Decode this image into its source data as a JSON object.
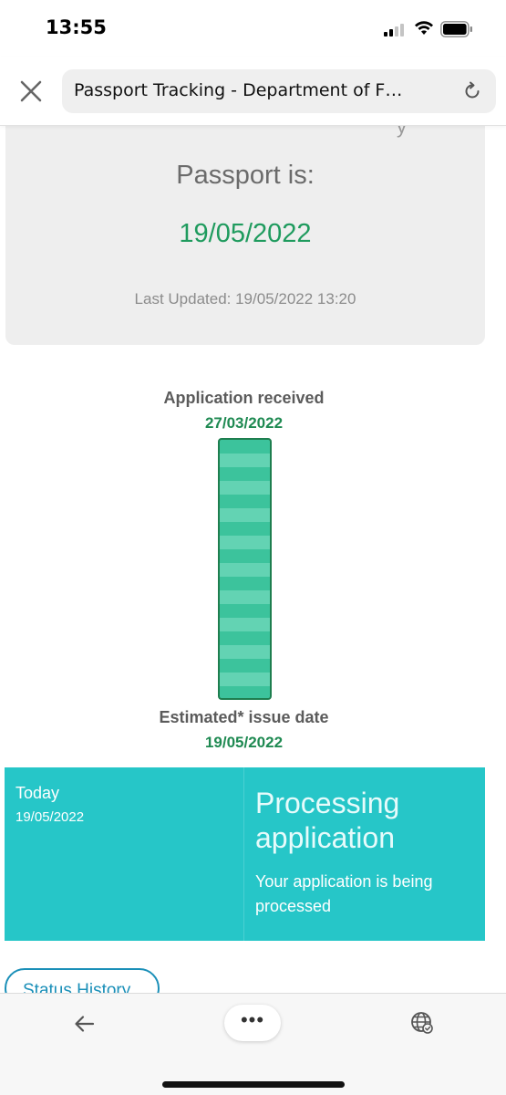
{
  "status_bar": {
    "time": "13:55"
  },
  "browser": {
    "url_title": "Passport Tracking - Department of F…"
  },
  "status_card": {
    "cut_off_text": "y",
    "passport_label": "Passport is:",
    "passport_date": "19/05/2022",
    "last_updated": "Last Updated: 19/05/2022 13:20"
  },
  "timeline": {
    "start_label": "Application received",
    "start_date": "27/03/2022",
    "end_label": "Estimated* issue date",
    "end_date": "19/05/2022",
    "progress_fraction": 1.0
  },
  "today_panel": {
    "label": "Today",
    "date": "19/05/2022",
    "status_title": "Processing application",
    "status_description": "Your application is being processed"
  },
  "status_history": {
    "label": "Status History"
  },
  "bottom_bar": {
    "more_label": "•••"
  },
  "colors": {
    "accent_green": "#1f9b5e",
    "progress_fill": "#3cc39c",
    "today_panel_bg": "#26c6c8",
    "link_blue": "#1a8fb8"
  }
}
